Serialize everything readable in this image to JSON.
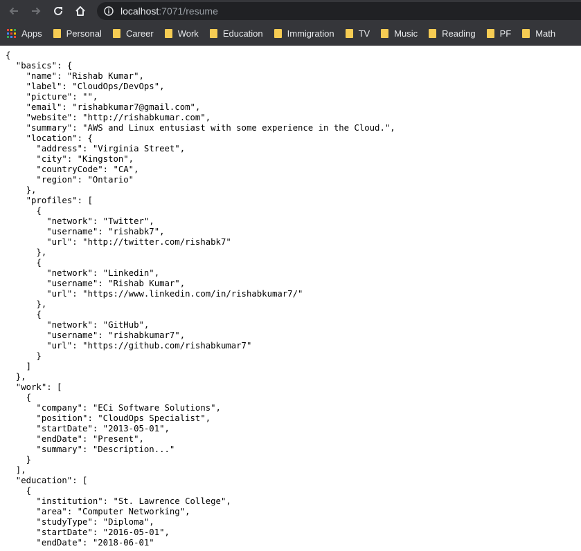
{
  "browser": {
    "url_host": "localhost",
    "url_path": ":7071/resume",
    "icons": {
      "back": "arrow-left-icon",
      "forward": "arrow-right-icon",
      "reload": "reload-icon",
      "home": "home-icon",
      "site_info": "info-icon"
    }
  },
  "bookmarks": [
    {
      "label": "Apps",
      "icon": "apps-grid-icon"
    },
    {
      "label": "Personal",
      "icon": "folder-icon"
    },
    {
      "label": "Career",
      "icon": "folder-icon"
    },
    {
      "label": "Work",
      "icon": "folder-icon"
    },
    {
      "label": "Education",
      "icon": "folder-icon"
    },
    {
      "label": "Immigration",
      "icon": "folder-icon"
    },
    {
      "label": "TV",
      "icon": "folder-icon"
    },
    {
      "label": "Music",
      "icon": "folder-icon"
    },
    {
      "label": "Reading",
      "icon": "folder-icon"
    },
    {
      "label": "PF",
      "icon": "folder-icon"
    },
    {
      "label": "Math",
      "icon": "folder-icon"
    }
  ],
  "colors": {
    "toolbar": "#35363a",
    "omnibox": "#202124",
    "folder": "#f6cc53"
  },
  "json_lines": [
    "{",
    "  \"basics\": {",
    "    \"name\": \"Rishab Kumar\",",
    "    \"label\": \"CloudOps/DevOps\",",
    "    \"picture\": \"\",",
    "    \"email\": \"rishabkumar7@gmail.com\",",
    "    \"website\": \"http://rishabkumar.com\",",
    "    \"summary\": \"AWS and Linux entusiast with some experience in the Cloud.\",",
    "    \"location\": {",
    "      \"address\": \"Virginia Street\",",
    "      \"city\": \"Kingston\",",
    "      \"countryCode\": \"CA\",",
    "      \"region\": \"Ontario\"",
    "    },",
    "    \"profiles\": [",
    "      {",
    "        \"network\": \"Twitter\",",
    "        \"username\": \"rishabk7\",",
    "        \"url\": \"http://twitter.com/rishabk7\"",
    "      },",
    "      {",
    "        \"network\": \"Linkedin\",",
    "        \"username\": \"Rishab Kumar\",",
    "        \"url\": \"https://www.linkedin.com/in/rishabkumar7/\"",
    "      },",
    "      {",
    "        \"network\": \"GitHub\",",
    "        \"username\": \"rishabkumar7\",",
    "        \"url\": \"https://github.com/rishabkumar7\"",
    "      }",
    "    ]",
    "  },",
    "  \"work\": [",
    "    {",
    "      \"company\": \"ECi Software Solutions\",",
    "      \"position\": \"CloudOps Specialist\",",
    "      \"startDate\": \"2013-05-01\",",
    "      \"endDate\": \"Present\",",
    "      \"summary\": \"Description...\"",
    "    }",
    "  ],",
    "  \"education\": [",
    "    {",
    "      \"institution\": \"St. Lawrence College\",",
    "      \"area\": \"Computer Networking\",",
    "      \"studyType\": \"Diploma\",",
    "      \"startDate\": \"2016-05-01\",",
    "      \"endDate\": \"2018-06-01\""
  ]
}
